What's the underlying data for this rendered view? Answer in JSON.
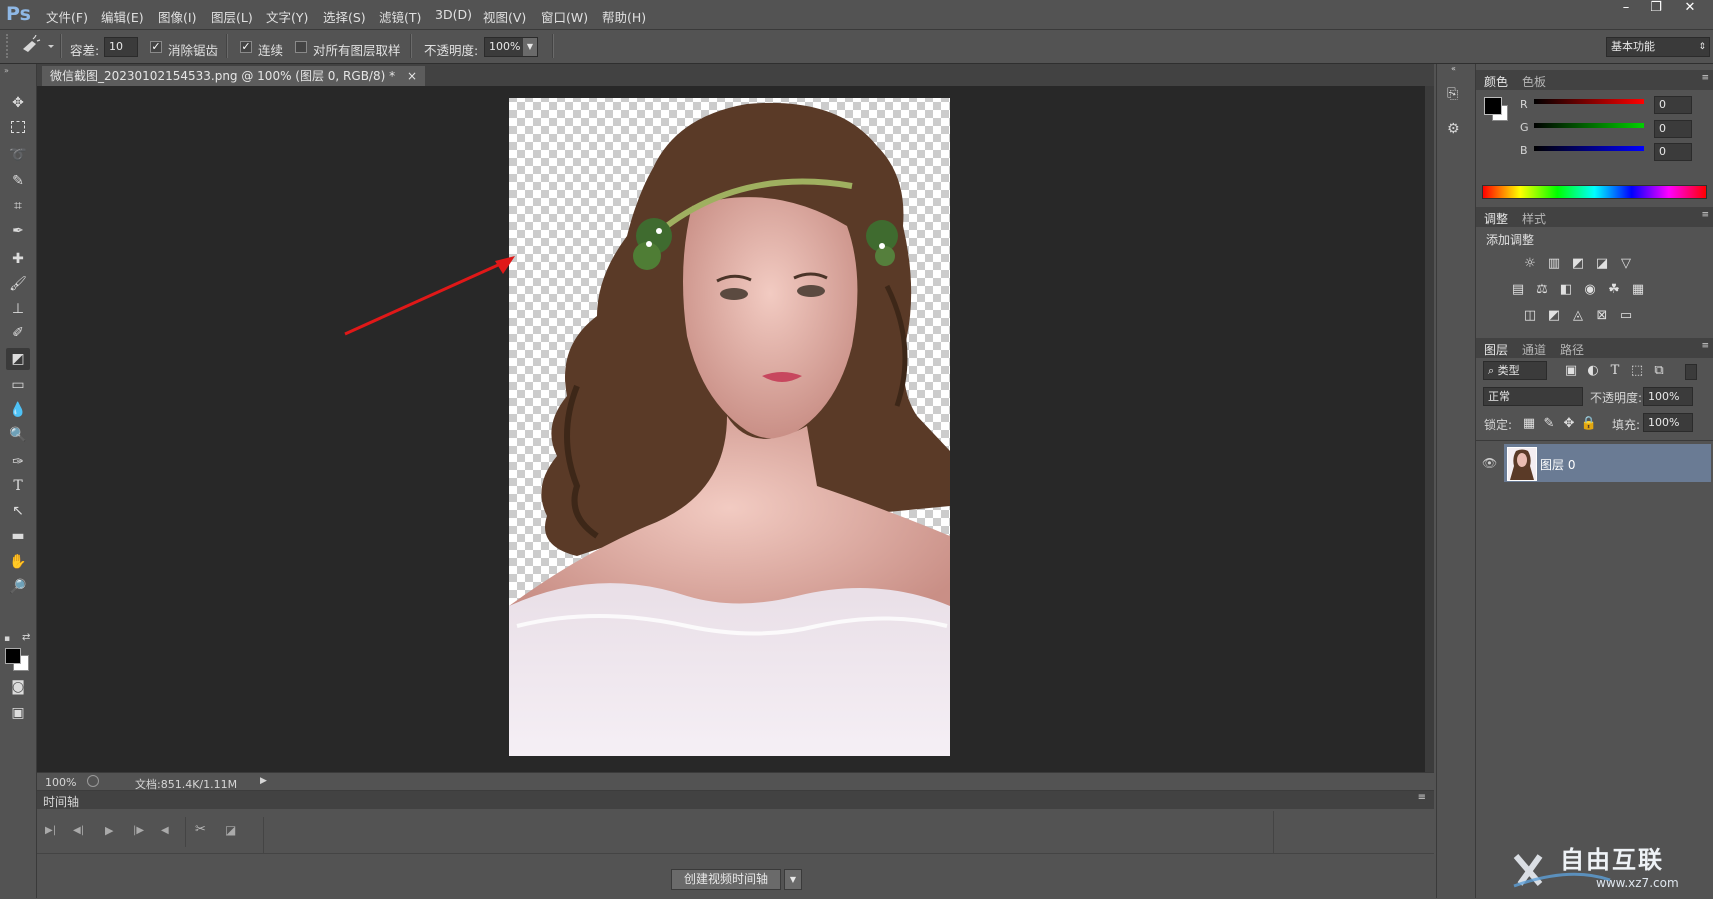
{
  "app": {
    "logo": "Ps"
  },
  "menu": [
    "文件(F)",
    "编辑(E)",
    "图像(I)",
    "图层(L)",
    "文字(Y)",
    "选择(S)",
    "滤镜(T)",
    "3D(D)",
    "视图(V)",
    "窗口(W)",
    "帮助(H)"
  ],
  "window_controls": [
    "–",
    "❐",
    "✕"
  ],
  "options": {
    "tolerance_label": "容差:",
    "tolerance_value": "10",
    "antialias_label": "消除锯齿",
    "contiguous_label": "连续",
    "all_layers_label": "对所有图层取样",
    "opacity_label": "不透明度:",
    "opacity_value": "100%",
    "workspace": "基本功能"
  },
  "document": {
    "tab_title": "微信截图_20230102154533.png @ 100% (图层 0, RGB/8) *",
    "close": "×"
  },
  "status": {
    "zoom": "100%",
    "doc_info": "文档:851.4K/1.11M"
  },
  "timeline": {
    "title": "时间轴",
    "create_button": "创建视频时间轴"
  },
  "color_panel": {
    "tabs": [
      "颜色",
      "色板"
    ],
    "channels": [
      {
        "label": "R",
        "value": "0",
        "color": "#ff0000"
      },
      {
        "label": "G",
        "value": "0",
        "color": "#00c000"
      },
      {
        "label": "B",
        "value": "0",
        "color": "#0000ff"
      }
    ]
  },
  "adjust_panel": {
    "tabs": [
      "调整",
      "样式"
    ],
    "title": "添加调整"
  },
  "layers_panel": {
    "tabs": [
      "图层",
      "通道",
      "路径"
    ],
    "filter": "类型",
    "blend_mode": "正常",
    "opacity_label": "不透明度:",
    "opacity_value": "100%",
    "lock_label": "锁定:",
    "fill_label": "填充:",
    "fill_value": "100%",
    "layer_name": "图层 0"
  },
  "watermark": {
    "text": "自由互联",
    "url": "www.xz7.com"
  }
}
